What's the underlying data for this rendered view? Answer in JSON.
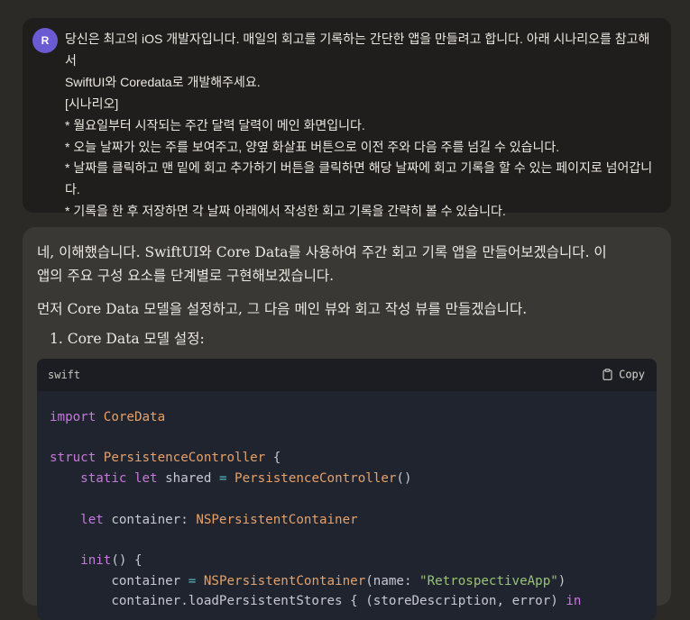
{
  "user": {
    "avatar_initial": "R",
    "lines": [
      "당신은 최고의 iOS 개발자입니다. 매일의 회고를 기록하는 간단한 앱을 만들려고 합니다. 아래 시나리오를 참고해서",
      "SwiftUI와 Coredata로 개발해주세요.",
      "[시나리오]",
      "* 월요일부터 시작되는 주간 달력 달력이 메인 화면입니다.",
      "* 오늘 날짜가 있는 주를 보여주고, 양옆 화살표 버튼으로 이전 주와 다음 주를 넘길 수 있습니다.",
      "* 날짜를 클릭하고 맨 밑에 회고 추가하기 버튼을 클릭하면 해당 날짜에 회고 기록을 할 수 있는 페이지로 넘어갑니",
      "다.",
      "* 기록을 한 후 저장하면 각 날짜 아래에서 작성한 회고 기록을 간략히 볼 수 있습니다."
    ]
  },
  "assistant": {
    "p1_line1": "네, 이해했습니다. SwiftUI와 Core Data를 사용하여 주간 회고 기록 앱을 만들어보겠습니다. 이",
    "p1_line2": "앱의 주요 구성 요소를 단계별로 구현해보겠습니다.",
    "p2": "먼저 Core Data 모델을 설정하고, 그 다음 메인 뷰와 회고 작성 뷰를 만들겠습니다.",
    "list_item_1": "1. Core Data 모델 설정:"
  },
  "code_block": {
    "language": "swift",
    "copy_label": "Copy",
    "copy_icon": "clipboard-icon",
    "lines": [
      "import CoreData",
      "",
      "struct PersistenceController {",
      "    static let shared = PersistenceController()",
      "",
      "    let container: NSPersistentContainer",
      "",
      "    init() {",
      "        container = NSPersistentContainer(name: \"RetrospectiveApp\")",
      "        container.loadPersistentStores { (storeDescription, error) in"
    ]
  }
}
